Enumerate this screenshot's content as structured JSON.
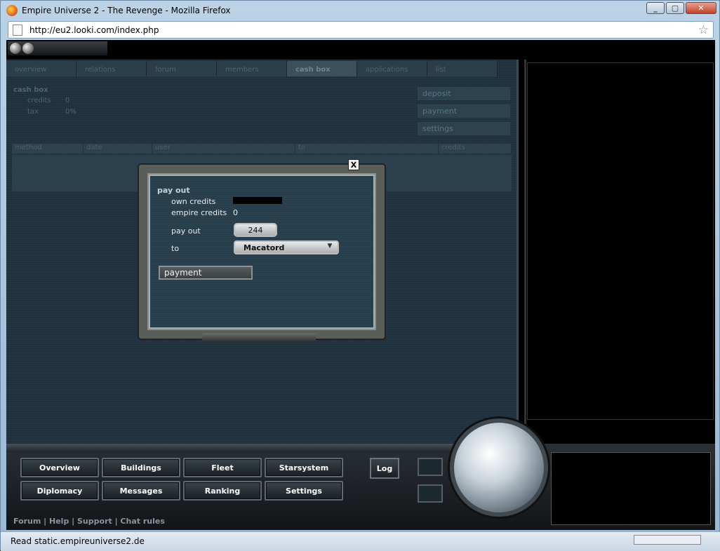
{
  "browser": {
    "title": "Empire Universe 2 - The Revenge - Mozilla Firefox",
    "url": "http://eu2.looki.com/index.php",
    "status": "Read static.empireuniverse2.de"
  },
  "tabs": [
    "overview",
    "relations",
    "forum",
    "members",
    "cash box",
    "applications",
    "list"
  ],
  "cashbox": {
    "title": "cash box",
    "credits_label": "credits",
    "credits_value": "0",
    "tax_label": "tax",
    "tax_value": "0%"
  },
  "side_buttons": {
    "deposit": "deposit",
    "payment": "payment",
    "settings": "settings"
  },
  "table_headers": [
    "method",
    "date",
    "user",
    "to",
    "credits"
  ],
  "dialog": {
    "close": "X",
    "title": "pay out",
    "own_credits_label": "own credits",
    "empire_credits_label": "empire credits",
    "empire_credits_value": "0",
    "pay_out_label": "pay out",
    "pay_out_value": "244",
    "to_label": "to",
    "to_value": "Macatord",
    "payment_button": "payment"
  },
  "nav": {
    "overview": "Overview",
    "buildings": "Buildings",
    "fleet": "Fleet",
    "starsystem": "Starsystem",
    "diplomacy": "Diplomacy",
    "messages": "Messages",
    "ranking": "Ranking",
    "settings": "Settings",
    "log": "Log"
  },
  "footer": "Forum | Help | Support | Chat rules"
}
